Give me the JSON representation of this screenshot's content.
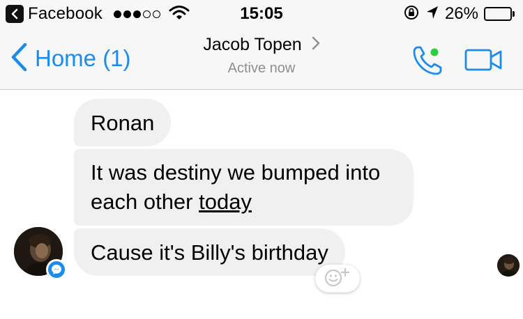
{
  "status_bar": {
    "back_app": "Facebook",
    "signal_bars_filled": 3,
    "signal_bars_total": 5,
    "time": "15:05",
    "battery_percent_text": "26%",
    "battery_level": 0.26
  },
  "nav": {
    "back_label": "Home (1)",
    "title": "Jacob Topen",
    "subtitle": "Active now"
  },
  "messages": [
    {
      "parts": [
        "Ronan"
      ]
    },
    {
      "line1": "It was destiny we bumped into",
      "line2_prefix": "each other ",
      "line2_underlined": "today"
    },
    {
      "parts": [
        "Cause it's Billy's birthday"
      ]
    }
  ],
  "icons": {
    "back_app": "back-arrow-icon",
    "wifi": "wifi-icon",
    "orientation_lock": "orientation-lock-icon",
    "location": "location-arrow-icon",
    "back": "chevron-left-icon",
    "disclosure": "chevron-right-icon",
    "call": "phone-icon",
    "video": "video-camera-icon",
    "messenger": "messenger-icon",
    "reaction": "smiley-plus-icon"
  },
  "colors": {
    "accent": "#1a8cf0",
    "active_dot": "#2ecc40",
    "bubble": "#f1f0f0",
    "bar_bg": "#f7f7f7",
    "subtitle": "#8e8e93"
  }
}
